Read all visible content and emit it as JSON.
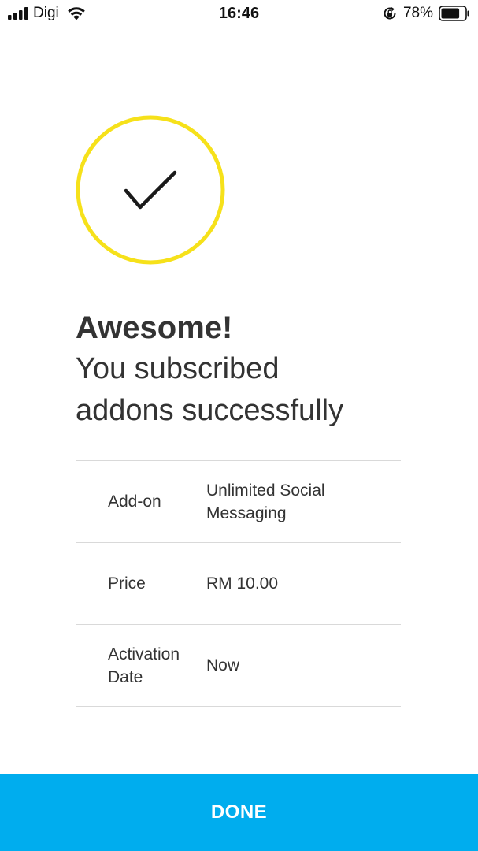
{
  "status_bar": {
    "carrier": "Digi",
    "time": "16:46",
    "battery_percent": "78%",
    "battery_level": 0.78,
    "icons": [
      "signal-icon",
      "wifi-icon",
      "rotation-lock-icon",
      "battery-icon"
    ]
  },
  "success": {
    "icon": "checkmark-icon",
    "circle_color": "#f6e11a",
    "title": "Awesome!",
    "message_line1": "You subscribed",
    "message_line2": "addons successfully"
  },
  "details": [
    {
      "label": "Add-on",
      "value": "Unlimited Social Messaging"
    },
    {
      "label": "Price",
      "value": "RM 10.00"
    },
    {
      "label": "Activation Date",
      "value": "Now"
    }
  ],
  "done_button": {
    "label": "DONE",
    "color": "#00adee"
  }
}
